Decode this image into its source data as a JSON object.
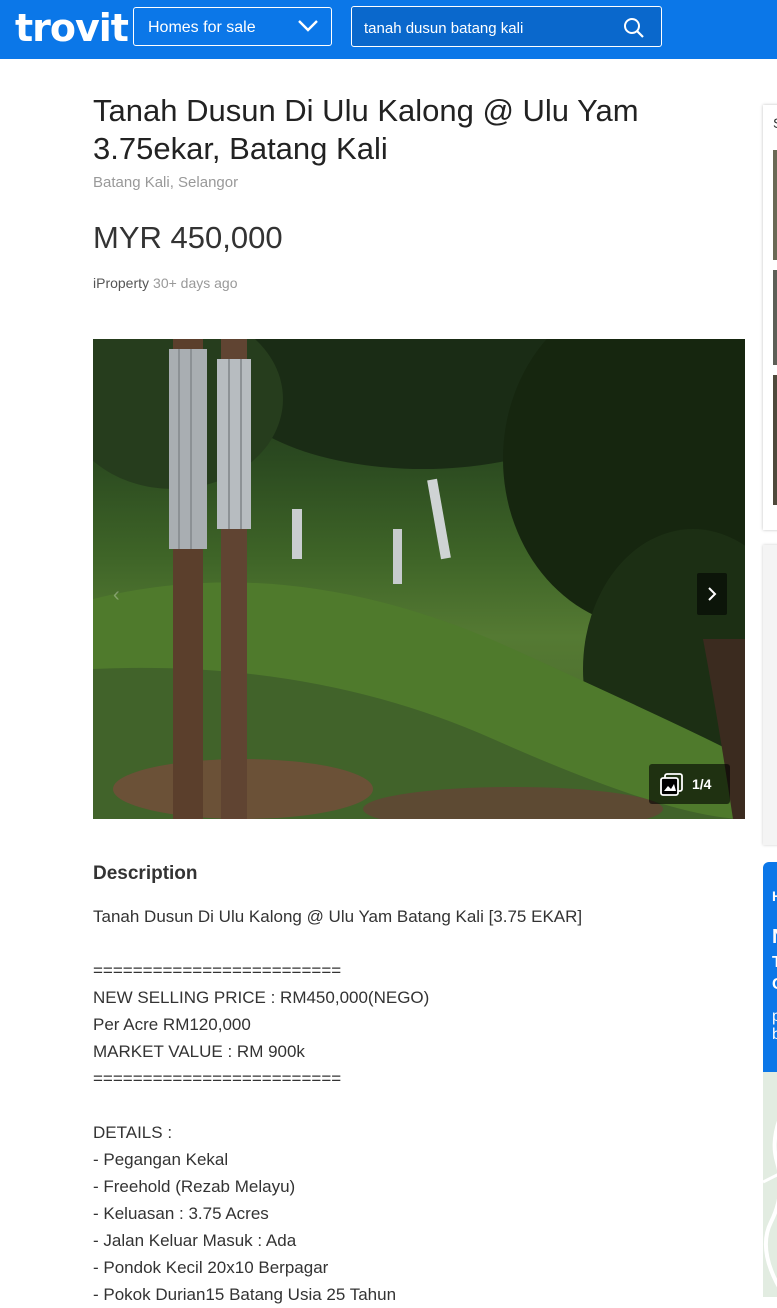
{
  "header": {
    "logo": "trovit",
    "category": "Homes for sale",
    "search_value": "tanah dusun batang kali",
    "search_icon": "search-icon"
  },
  "listing": {
    "title": "Tanah Dusun Di Ulu Kalong @ Ulu Yam 3.75ekar, Batang Kali",
    "location": "Batang Kali, Selangor",
    "price": "MYR 450,000",
    "source": "iProperty",
    "age": "30+ days ago"
  },
  "gallery": {
    "counter": "1/4",
    "current": 1,
    "total": 4
  },
  "description": {
    "heading": "Description",
    "lines": [
      "Tanah Dusun Di Ulu Kalong @ Ulu Yam Batang Kali [3.75 EKAR]",
      "",
      "=========================",
      "NEW SELLING PRICE : RM450,000(NEGO)",
      "Per Acre RM120,000",
      "MARKET VALUE : RM 900k",
      "=========================",
      "",
      "DETAILS :",
      "- Pegangan Kekal",
      "- Freehold (Rezab Melayu)",
      "- Keluasan : 3.75 Acres",
      "- Jalan Keluar Masuk : Ada",
      "- Pondok Kecil 20x10 Berpagar",
      "- Pokok Durian15 Batang Usia 25 Tahun"
    ]
  },
  "sidebar": {
    "card1_text": "S",
    "promo_lines": [
      "H",
      "N",
      "T",
      "C",
      "p",
      "b"
    ]
  }
}
